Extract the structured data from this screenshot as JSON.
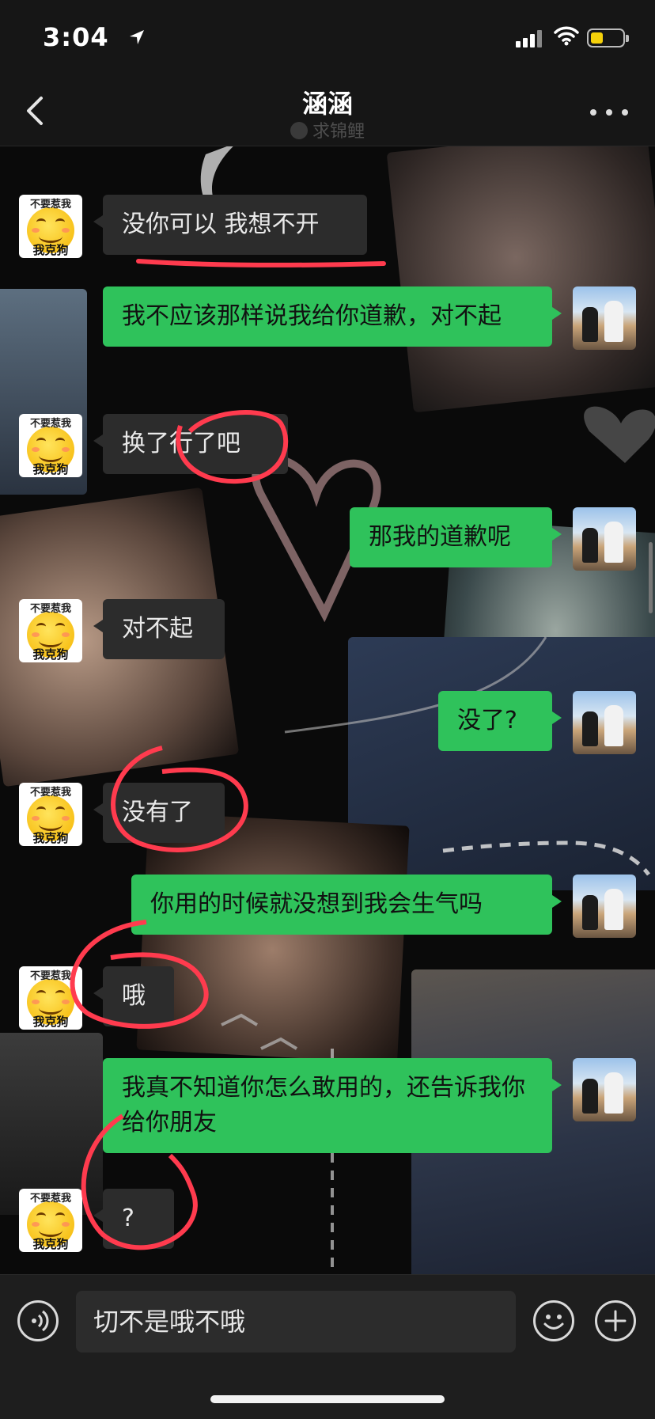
{
  "status": {
    "time": "3:04",
    "battery_level": 0.4
  },
  "nav": {
    "title": "涵涵",
    "subtitle": "求锦鲤"
  },
  "avatar_caption": {
    "top": "不要惹我",
    "bottom": "我克狗"
  },
  "messages": [
    {
      "side": "in",
      "text": "没你可以 我想不开"
    },
    {
      "side": "out",
      "text": "我不应该那样说我给你道歉，对不起"
    },
    {
      "side": "in",
      "text": "换了行了吧"
    },
    {
      "side": "out",
      "text": "那我的道歉呢"
    },
    {
      "side": "in",
      "text": "对不起"
    },
    {
      "side": "out",
      "text": "没了?"
    },
    {
      "side": "in",
      "text": "没有了"
    },
    {
      "side": "out",
      "text": "你用的时候就没想到我会生气吗"
    },
    {
      "side": "in",
      "text": "哦"
    },
    {
      "side": "out",
      "text": "我真不知道你怎么敢用的，还告诉我你给你朋友"
    },
    {
      "side": "in",
      "text": "?"
    }
  ],
  "input": {
    "value": "切不是哦不哦"
  },
  "colors": {
    "out_bubble": "#2fc25b",
    "in_bubble": "#2c2c2c",
    "annotation": "#ff3b4e"
  }
}
